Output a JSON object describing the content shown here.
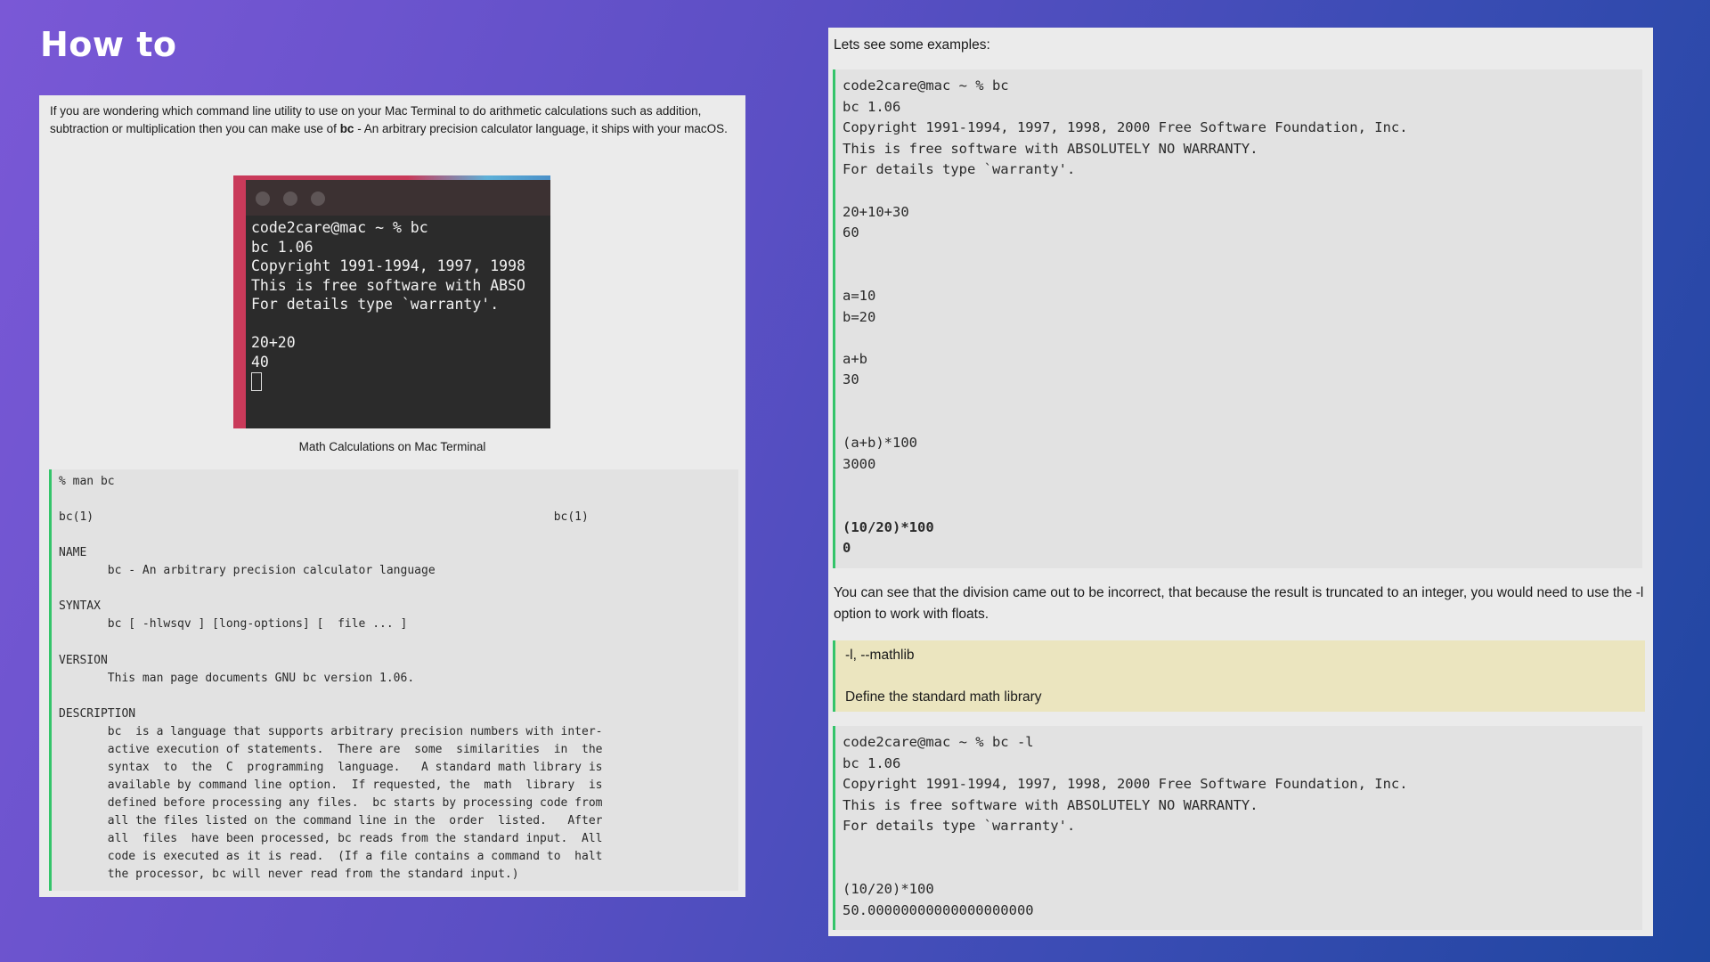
{
  "page": {
    "heading": "How to"
  },
  "left": {
    "intro_before": "If you are wondering which command line utility to use on your Mac Terminal to do arithmetic calculations such as addition, subtraction or multiplication then you can make use of ",
    "intro_bold": "bc",
    "intro_after": " - An arbitrary precision calculator language, it ships with your macOS.",
    "terminal_lines": [
      "code2care@mac ~ % bc",
      "bc 1.06",
      "Copyright 1991-1994, 1997, 1998",
      "This is free software with ABSO",
      "For details type `warranty'.",
      "",
      "20+20",
      "40"
    ],
    "caption": "Math Calculations on Mac Terminal",
    "man_lines": [
      "% man bc",
      "",
      "bc(1)                                                                  bc(1)",
      "",
      "NAME",
      "       bc - An arbitrary precision calculator language",
      "",
      "SYNTAX",
      "       bc [ -hlwsqv ] [long-options] [  file ... ]",
      "",
      "VERSION",
      "       This man page documents GNU bc version 1.06.",
      "",
      "DESCRIPTION",
      "       bc  is a language that supports arbitrary precision numbers with inter-",
      "       active execution of statements.  There are  some  similarities  in  the",
      "       syntax  to  the  C  programming  language.   A standard math library is",
      "       available by command line option.  If requested, the  math  library  is",
      "       defined before processing any files.  bc starts by processing code from",
      "       all the files listed on the command line in the  order  listed.   After",
      "       all  files  have been processed, bc reads from the standard input.  All",
      "       code is executed as it is read.  (If a file contains a command to  halt",
      "       the processor, bc will never read from the standard input.)"
    ]
  },
  "right": {
    "examples_label": "Lets see some examples:",
    "code1_lines": [
      "code2care@mac ~ % bc",
      "bc 1.06",
      "Copyright 1991-1994, 1997, 1998, 2000 Free Software Foundation, Inc.",
      "This is free software with ABSOLUTELY NO WARRANTY.",
      "For details type `warranty'.",
      "",
      "20+10+30",
      "60",
      "",
      "",
      "a=10",
      "b=20",
      "",
      "a+b",
      "30",
      "",
      "",
      "(a+b)*100",
      "3000",
      "",
      "",
      "(10/20)*100",
      "0"
    ],
    "explanation": "You can see that the division came out to be incorrect, that because the result is truncated to an integer, you would need to use the -l option to work with floats.",
    "note_option": "-l, --mathlib",
    "note_desc": "Define the standard math library",
    "code2_lines": [
      "code2care@mac ~ % bc -l",
      "bc 1.06",
      "Copyright 1991-1994, 1997, 1998, 2000 Free Software Foundation, Inc.",
      "This is free software with ABSOLUTELY NO WARRANTY.",
      "For details type `warranty'.",
      "",
      "",
      "(10/20)*100",
      "50.00000000000000000000"
    ]
  },
  "colors": {
    "accent_green": "#34c46a",
    "note_bg": "#ebe5bf",
    "panel_bg": "#ebebeb"
  }
}
